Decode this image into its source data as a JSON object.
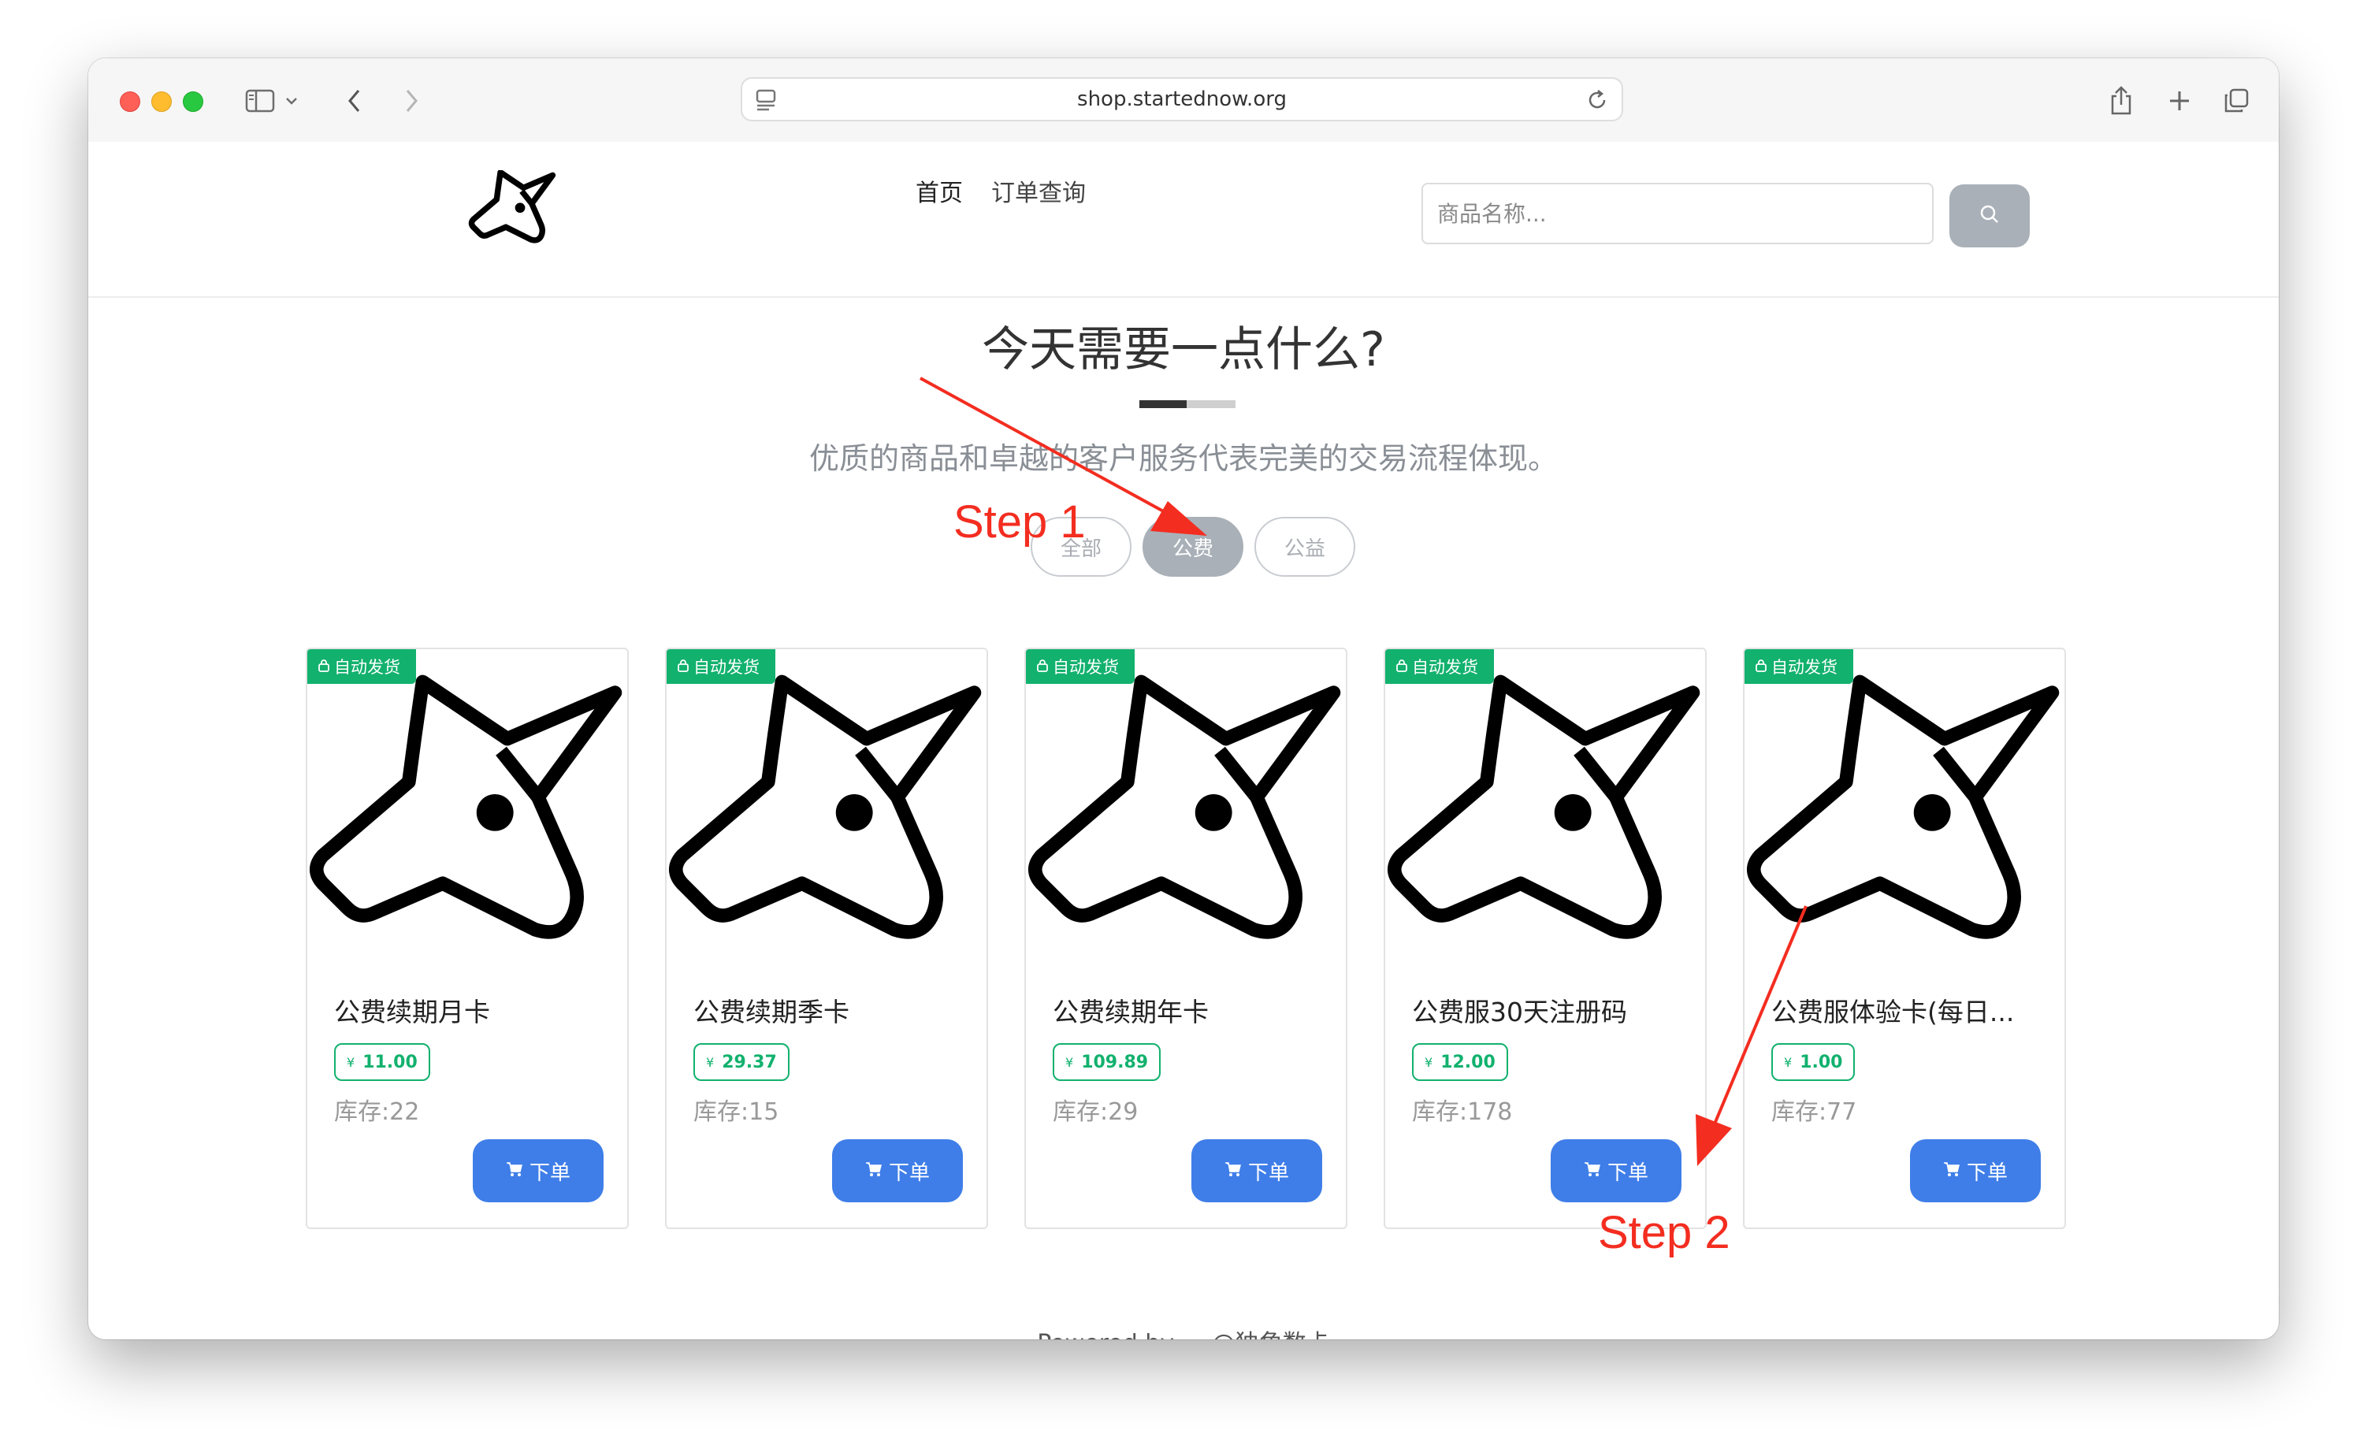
{
  "browser": {
    "url": "shop.startednow.org"
  },
  "header": {
    "nav": {
      "home": "首页",
      "orders": "订单查询"
    },
    "search": {
      "placeholder": "商品名称..."
    }
  },
  "hero": {
    "title": "今天需要一点什么?",
    "subtitle": "优质的商品和卓越的客户服务代表完美的交易流程体现。"
  },
  "filters": {
    "all": "全部",
    "paid": "公费",
    "charity": "公益",
    "active": "公费"
  },
  "product_common": {
    "badge": "自动发货",
    "currency": "¥",
    "stock_label": "库存:",
    "order_label": "下单"
  },
  "products": [
    {
      "name": "公费续期月卡",
      "price": "11.00",
      "stock": "22"
    },
    {
      "name": "公费续期季卡",
      "price": "29.37",
      "stock": "15"
    },
    {
      "name": "公费续期年卡",
      "price": "109.89",
      "stock": "29"
    },
    {
      "name": "公费服30天注册码",
      "price": "12.00",
      "stock": "178"
    },
    {
      "name": "公费服体验卡(每日...",
      "price": "1.00",
      "stock": "77"
    }
  ],
  "footer": {
    "text": "Powered by ... @独角数卡"
  },
  "annotations": {
    "step1": "Step 1",
    "step2": "Step 2",
    "color": "#f32d20"
  },
  "colors": {
    "accent_blue": "#3f7ee8",
    "badge_green": "#12b16e",
    "filter_active": "#a9b0b8"
  }
}
